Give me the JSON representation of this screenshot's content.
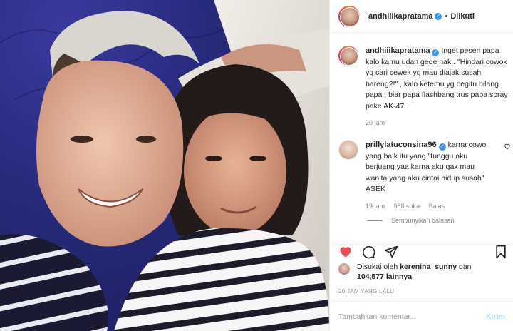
{
  "header": {
    "username": "andhiiikapratama",
    "follow_status": "Diikuti",
    "separator": "•"
  },
  "caption": {
    "username": "andhiiikapratama",
    "text": "Inget pesen papa kalo kamu udah gede nak.. \"Hindari cowok yg cari cewek yg mau diajak susah bareng2!\" , kalo ketemu yg begitu bilang papa , biar papa flashbang trus papa spray pake AK-47.",
    "time": "20 jam"
  },
  "reply": {
    "username": "prillylatuconsina96",
    "text": "karna cowo yang baik itu yang \"tunggu aku berjuang yaa karna aku gak mau wanita yang aku cintai hidup susah\" ASEK",
    "time": "19 jam",
    "likes": "958 suka",
    "reply_label": "Balas",
    "hide_replies": "Sembunyikan balasan"
  },
  "likes": {
    "prefix": "Disukai oleh",
    "user": "kerenina_sunny",
    "and": "dan",
    "count": "104,577",
    "suffix": "lainnya"
  },
  "timestamp": "20 JAM YANG LALU",
  "comment_box": {
    "placeholder": "Tambahkan komentar...",
    "post_label": "Kirim"
  },
  "colors": {
    "like_red": "#ed4956",
    "verified_blue": "#3897f0",
    "post_button": "#b2dffc"
  }
}
